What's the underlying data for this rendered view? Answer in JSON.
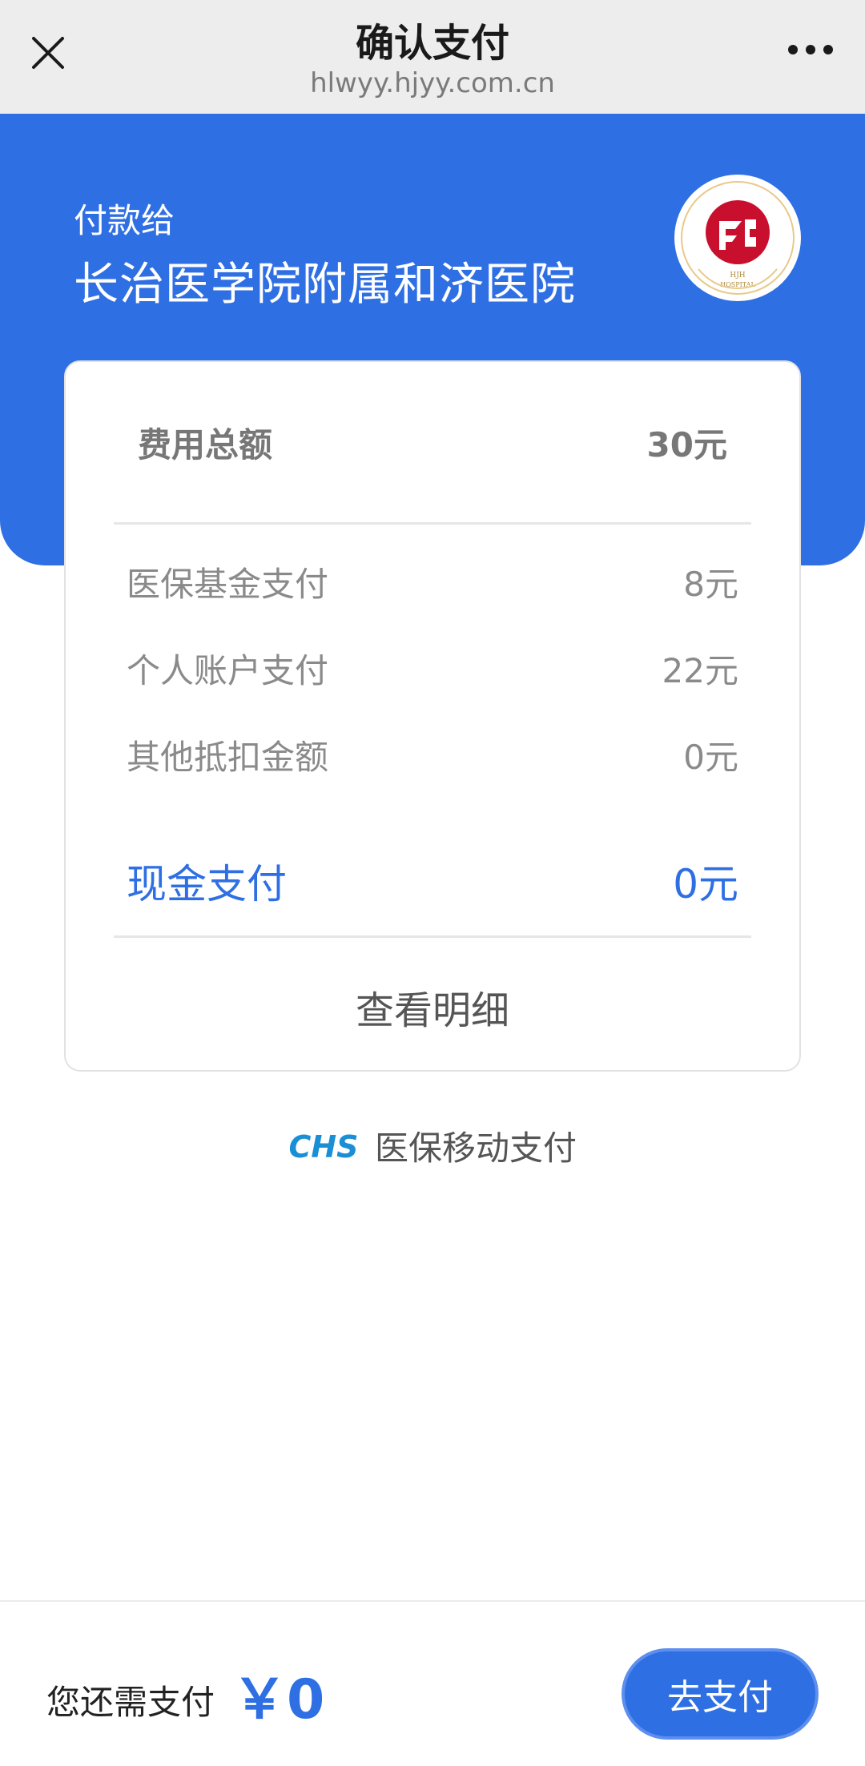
{
  "nav": {
    "title": "确认支付",
    "url": "hlwyy.hjyy.com.cn",
    "close_icon": "close-icon",
    "more_icon": "more-dots-icon"
  },
  "header": {
    "pay_to_label": "付款给",
    "hospital_name": "长治医学院附属和济医院",
    "logo": "hospital-logo",
    "logo_text": "长治医学院附属和济医院 HJH HOSPITAL"
  },
  "card": {
    "total_label": "费用总额",
    "total_value": "30元",
    "rows": [
      {
        "label": "医保基金支付",
        "value": "8元"
      },
      {
        "label": "个人账户支付",
        "value": "22元"
      },
      {
        "label": "其他抵扣金额",
        "value": "0元"
      }
    ],
    "cash_label": "现金支付",
    "cash_value": "0元",
    "detail_link": "查看明细"
  },
  "chs": {
    "logo_text": "CHS",
    "label": "医保移动支付"
  },
  "bottom": {
    "need_label": "您还需支付",
    "need_amount": "￥0",
    "pay_button": "去支付"
  },
  "colors": {
    "accent": "#2f6fe4",
    "nav_bg": "#ededed",
    "logo_red": "#c8102e"
  }
}
